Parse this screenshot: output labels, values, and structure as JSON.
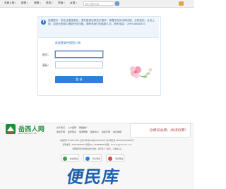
{
  "nav": {
    "items": [
      {
        "label": "总西人网",
        "has_caret": true
      },
      {
        "label": "新闻",
        "has_caret": true
      },
      {
        "label": "我看",
        "has_caret": true
      },
      {
        "label": "信息",
        "has_caret": true
      },
      {
        "label": "求租",
        "has_caret": true
      },
      {
        "label": "乡镇",
        "has_caret": true
      }
    ],
    "search_placeholder": "输入搜索内容"
  },
  "login": {
    "notice": "温馨提示：您无法直接发帖，请先登录后再进行操作！请遵守相关法律法规，文明发帖，合法上网。如您在使用中遇到任何问题，请联系我们的客服人员。联系电话：0999-8888333",
    "title": "欢迎登录中国西人网",
    "username_label": "账号：",
    "password_label": "密码：",
    "login_button": "登 录"
  },
  "footer": {
    "logo_text": "岳西人网",
    "logo_sub": "www.Yuexiren.com",
    "links_row1": [
      "关于我们",
      "人才招聘",
      "网络推广"
    ],
    "links_row2": [
      "免责声明",
      "站长联系",
      "使用帮助",
      "留言中心",
      "版权声明",
      "信息举报"
    ],
    "slogan": "为建设岳西，出谋划策！",
    "copy_lines": [
      "版权所有©2008-2019 岳西人网 皖ICP备10000000号  皖公网安备 34000000000000号",
      "客服电话：0999-8888333  客服QQ：888888888  邮箱：service@yuexiren.com",
      "本网站所有内容均由用户发布，仅代表个人观点，与本站无关"
    ],
    "badges": [
      {
        "label": "诚信网站",
        "color": "#3aa14d"
      },
      {
        "label": "安全联盟",
        "color": "#2c7fd2"
      },
      {
        "label": "可信网站",
        "color": "#d94a3a"
      }
    ]
  },
  "watermark": "便民库"
}
